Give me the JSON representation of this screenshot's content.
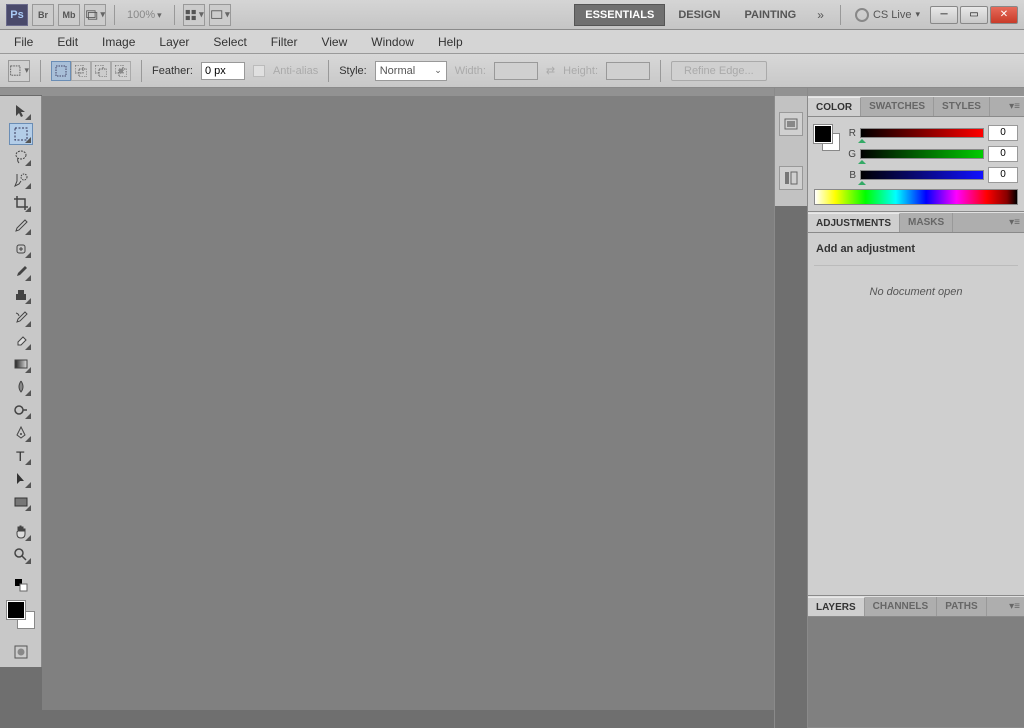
{
  "app": {
    "logo": "Ps",
    "br": "Br",
    "mb": "Mb",
    "zoom": "100%"
  },
  "workspaces": {
    "essentials": "ESSENTIALS",
    "design": "DESIGN",
    "painting": "PAINTING",
    "cslive": "CS Live"
  },
  "menu": {
    "file": "File",
    "edit": "Edit",
    "image": "Image",
    "layer": "Layer",
    "select": "Select",
    "filter": "Filter",
    "view": "View",
    "window": "Window",
    "help": "Help"
  },
  "options": {
    "feather_label": "Feather:",
    "feather_value": "0 px",
    "anti_alias": "Anti-alias",
    "style_label": "Style:",
    "style_value": "Normal",
    "width_label": "Width:",
    "height_label": "Height:",
    "refine": "Refine Edge..."
  },
  "panels": {
    "color": {
      "tab_color": "COLOR",
      "tab_swatches": "SWATCHES",
      "tab_styles": "STYLES",
      "r": "R",
      "g": "G",
      "b": "B",
      "r_val": "0",
      "g_val": "0",
      "b_val": "0"
    },
    "adjustments": {
      "tab_adjustments": "ADJUSTMENTS",
      "tab_masks": "MASKS",
      "title": "Add an adjustment",
      "msg": "No document open"
    },
    "layers": {
      "tab_layers": "LAYERS",
      "tab_channels": "CHANNELS",
      "tab_paths": "PATHS"
    }
  }
}
